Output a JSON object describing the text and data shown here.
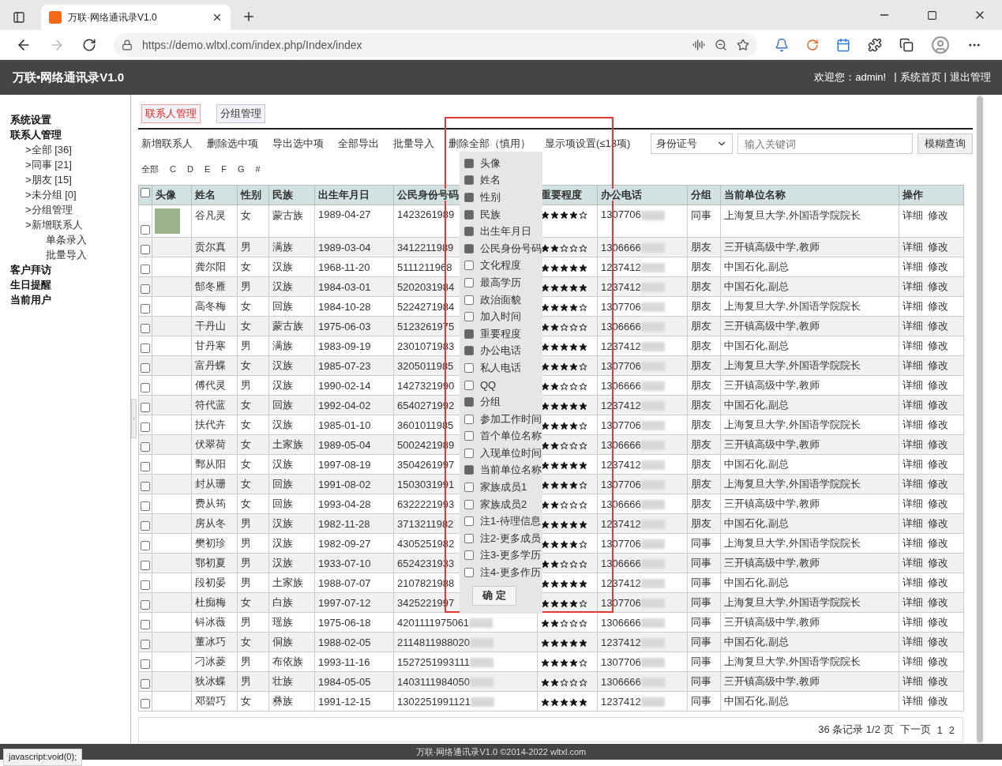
{
  "browser": {
    "tab_title": "万联·网络通讯录V1.0",
    "url": "https://demo.wltxl.com/index.php/Index/index"
  },
  "header": {
    "title": "万联•网络通讯录V1.0",
    "items": [
      {
        "kind": "text",
        "label": "欢迎您：admin!"
      },
      {
        "kind": "separator",
        "label": "|"
      },
      {
        "kind": "link",
        "label": "系统首页"
      },
      {
        "kind": "separator",
        "label": "|"
      },
      {
        "kind": "link",
        "label": "退出管理"
      }
    ]
  },
  "sidebar": {
    "items": [
      {
        "label": "系统设置"
      },
      {
        "label": "联系人管理",
        "children": [
          {
            "label": ">全部 [36]"
          },
          {
            "label": ">同事 [21]"
          },
          {
            "label": ">朋友 [15]"
          },
          {
            "label": ">未分组 [0]"
          },
          {
            "label": ">分组管理"
          },
          {
            "label": ">新增联系人",
            "children": [
              {
                "label": "单条录入"
              },
              {
                "label": "批量导入"
              }
            ]
          }
        ]
      },
      {
        "label": "客户拜访"
      },
      {
        "label": "生日提醒"
      },
      {
        "label": "当前用户"
      }
    ]
  },
  "tabs": [
    {
      "label": "联系人管理",
      "selected": true
    },
    {
      "label": "分组管理",
      "selected": false
    }
  ],
  "toolbar": {
    "actions": [
      "新增联系人",
      "删除选中项",
      "导出选中项",
      "全部导出",
      "批量导入",
      "删除全部（慎用）",
      "显示项设置(≤13项)"
    ],
    "letters": [
      "全部",
      "C",
      "D",
      "E",
      "F",
      "G",
      "#"
    ]
  },
  "search": {
    "field": "身份证号",
    "placeholder": "输入关键词",
    "button": "模糊查询"
  },
  "table": {
    "select_all_checked": false,
    "columns": [
      "头像",
      "姓名",
      "性别",
      "民族",
      "出生年月日",
      "公民身份号码",
      "重要程度",
      "办公电话",
      "分组",
      "当前单位名称",
      "操作"
    ],
    "rows": [
      {
        "checked": false,
        "photo": true,
        "name": "谷凡灵",
        "gender": "女",
        "ethnicity": "蒙古族",
        "birth": "1989-04-27",
        "id": "1423261989",
        "id_blurred": false,
        "stars": 4,
        "phone": "1307706",
        "group": "同事",
        "company": "上海复旦大学,外国语学院院长",
        "actions": [
          "详细",
          "修改"
        ]
      },
      {
        "checked": false,
        "photo": false,
        "name": "贡尔真",
        "gender": "男",
        "ethnicity": "满族",
        "birth": "1989-03-04",
        "id": "3412211989",
        "id_blurred": false,
        "stars": 2,
        "phone": "1306666",
        "group": "朋友",
        "company": "三开镇高级中学,教师",
        "actions": [
          "详细",
          "修改"
        ]
      },
      {
        "checked": false,
        "photo": false,
        "name": "龚尔阳",
        "gender": "女",
        "ethnicity": "汉族",
        "birth": "1968-11-20",
        "id": "5111211968",
        "id_blurred": false,
        "stars": 5,
        "phone": "1237412",
        "group": "朋友",
        "company": "中国石化,副总",
        "actions": [
          "详细",
          "修改"
        ]
      },
      {
        "checked": false,
        "photo": false,
        "name": "郜冬雁",
        "gender": "男",
        "ethnicity": "汉族",
        "birth": "1984-03-01",
        "id": "5202031984",
        "id_blurred": false,
        "stars": 5,
        "phone": "1237412",
        "group": "朋友",
        "company": "中国石化,副总",
        "actions": [
          "详细",
          "修改"
        ]
      },
      {
        "checked": false,
        "photo": false,
        "name": "高冬梅",
        "gender": "女",
        "ethnicity": "回族",
        "birth": "1984-10-28",
        "id": "5224271984",
        "id_blurred": false,
        "stars": 4,
        "phone": "1307706",
        "group": "朋友",
        "company": "上海复旦大学,外国语学院院长",
        "actions": [
          "详细",
          "修改"
        ]
      },
      {
        "checked": false,
        "photo": false,
        "name": "干丹山",
        "gender": "女",
        "ethnicity": "蒙古族",
        "birth": "1975-06-03",
        "id": "5123261975",
        "id_blurred": false,
        "stars": 2,
        "phone": "1306666",
        "group": "朋友",
        "company": "三开镇高级中学,教师",
        "actions": [
          "详细",
          "修改"
        ]
      },
      {
        "checked": false,
        "photo": false,
        "name": "甘丹寒",
        "gender": "男",
        "ethnicity": "满族",
        "birth": "1983-09-19",
        "id": "2301071983",
        "id_blurred": false,
        "stars": 5,
        "phone": "1237412",
        "group": "朋友",
        "company": "中国石化,副总",
        "actions": [
          "详细",
          "修改"
        ]
      },
      {
        "checked": false,
        "photo": false,
        "name": "富丹蝶",
        "gender": "女",
        "ethnicity": "汉族",
        "birth": "1985-07-23",
        "id": "3205011985",
        "id_blurred": false,
        "stars": 4,
        "phone": "1307706",
        "group": "朋友",
        "company": "上海复旦大学,外国语学院院长",
        "actions": [
          "详细",
          "修改"
        ]
      },
      {
        "checked": false,
        "photo": false,
        "name": "傅代灵",
        "gender": "男",
        "ethnicity": "汉族",
        "birth": "1990-02-14",
        "id": "1427321990",
        "id_blurred": false,
        "stars": 2,
        "phone": "1306666",
        "group": "朋友",
        "company": "三开镇高级中学,教师",
        "actions": [
          "详细",
          "修改"
        ]
      },
      {
        "checked": false,
        "photo": false,
        "name": "符代蓝",
        "gender": "女",
        "ethnicity": "回族",
        "birth": "1992-04-02",
        "id": "6540271992",
        "id_blurred": false,
        "stars": 5,
        "phone": "1237412",
        "group": "朋友",
        "company": "中国石化,副总",
        "actions": [
          "详细",
          "修改"
        ]
      },
      {
        "checked": false,
        "photo": false,
        "name": "扶代卉",
        "gender": "女",
        "ethnicity": "汉族",
        "birth": "1985-01-10",
        "id": "3601011985",
        "id_blurred": false,
        "stars": 4,
        "phone": "1307706",
        "group": "朋友",
        "company": "上海复旦大学,外国语学院院长",
        "actions": [
          "详细",
          "修改"
        ]
      },
      {
        "checked": false,
        "photo": false,
        "name": "伏翠荷",
        "gender": "女",
        "ethnicity": "土家族",
        "birth": "1989-05-04",
        "id": "5002421989",
        "id_blurred": false,
        "stars": 2,
        "phone": "1306666",
        "group": "朋友",
        "company": "三开镇高级中学,教师",
        "actions": [
          "详细",
          "修改"
        ]
      },
      {
        "checked": false,
        "photo": false,
        "name": "鄄从阳",
        "gender": "女",
        "ethnicity": "汉族",
        "birth": "1997-08-19",
        "id": "3504261997",
        "id_blurred": false,
        "stars": 5,
        "phone": "1237412",
        "group": "朋友",
        "company": "中国石化,副总",
        "actions": [
          "详细",
          "修改"
        ]
      },
      {
        "checked": false,
        "photo": false,
        "name": "封从珊",
        "gender": "女",
        "ethnicity": "回族",
        "birth": "1991-08-02",
        "id": "1503031991",
        "id_blurred": false,
        "stars": 4,
        "phone": "1307706",
        "group": "朋友",
        "company": "上海复旦大学,外国语学院院长",
        "actions": [
          "详细",
          "修改"
        ]
      },
      {
        "checked": false,
        "photo": false,
        "name": "费从筠",
        "gender": "女",
        "ethnicity": "回族",
        "birth": "1993-04-28",
        "id": "6322221993",
        "id_blurred": false,
        "stars": 2,
        "phone": "1306666",
        "group": "朋友",
        "company": "三开镇高级中学,教师",
        "actions": [
          "详细",
          "修改"
        ]
      },
      {
        "checked": false,
        "photo": false,
        "name": "房从冬",
        "gender": "男",
        "ethnicity": "汉族",
        "birth": "1982-11-28",
        "id": "3713211982",
        "id_blurred": false,
        "stars": 5,
        "phone": "1237412",
        "group": "朋友",
        "company": "中国石化,副总",
        "actions": [
          "详细",
          "修改"
        ]
      },
      {
        "checked": false,
        "photo": false,
        "name": "樊初珍",
        "gender": "男",
        "ethnicity": "汉族",
        "birth": "1982-09-27",
        "id": "4305251982",
        "id_blurred": false,
        "stars": 4,
        "phone": "1307706",
        "group": "同事",
        "company": "上海复旦大学,外国语学院院长",
        "actions": [
          "详细",
          "修改"
        ]
      },
      {
        "checked": false,
        "photo": false,
        "name": "鄂初夏",
        "gender": "男",
        "ethnicity": "汉族",
        "birth": "1933-07-10",
        "id": "6524231933",
        "id_blurred": false,
        "stars": 2,
        "phone": "1306666",
        "group": "同事",
        "company": "三开镇高级中学,教师",
        "actions": [
          "详细",
          "修改"
        ]
      },
      {
        "checked": false,
        "photo": false,
        "name": "段初晏",
        "gender": "男",
        "ethnicity": "土家族",
        "birth": "1988-07-07",
        "id": "2107821988",
        "id_blurred": false,
        "stars": 5,
        "phone": "1237412",
        "group": "同事",
        "company": "中国石化,副总",
        "actions": [
          "详细",
          "修改"
        ]
      },
      {
        "checked": false,
        "photo": false,
        "name": "杜痴梅",
        "gender": "女",
        "ethnicity": "白族",
        "birth": "1997-07-12",
        "id": "3425221997",
        "id_blurred": false,
        "stars": 4,
        "phone": "1307706",
        "group": "同事",
        "company": "上海复旦大学,外国语学院院长",
        "actions": [
          "详细",
          "修改"
        ]
      },
      {
        "checked": false,
        "photo": false,
        "name": "钭冰薇",
        "gender": "男",
        "ethnicity": "瑶族",
        "birth": "1975-06-18",
        "id": "4201111975061",
        "id_blurred": true,
        "stars": 2,
        "phone": "1306666",
        "group": "同事",
        "company": "三开镇高级中学,教师",
        "actions": [
          "详细",
          "修改"
        ]
      },
      {
        "checked": false,
        "photo": false,
        "name": "董冰巧",
        "gender": "女",
        "ethnicity": "侗族",
        "birth": "1988-02-05",
        "id": "2114811988020",
        "id_blurred": true,
        "stars": 5,
        "phone": "1237412",
        "group": "同事",
        "company": "中国石化,副总",
        "actions": [
          "详细",
          "修改"
        ]
      },
      {
        "checked": false,
        "photo": false,
        "name": "刁冰菱",
        "gender": "男",
        "ethnicity": "布依族",
        "birth": "1993-11-16",
        "id": "1527251993111",
        "id_blurred": true,
        "stars": 4,
        "phone": "1307706",
        "group": "同事",
        "company": "上海复旦大学,外国语学院院长",
        "actions": [
          "详细",
          "修改"
        ]
      },
      {
        "checked": false,
        "photo": false,
        "name": "狄冰蝶",
        "gender": "男",
        "ethnicity": "壮族",
        "birth": "1984-05-05",
        "id": "1403111984050",
        "id_blurred": true,
        "stars": 2,
        "phone": "1306666",
        "group": "同事",
        "company": "三开镇高级中学,教师",
        "actions": [
          "详细",
          "修改"
        ]
      },
      {
        "checked": false,
        "photo": false,
        "name": "邓碧巧",
        "gender": "女",
        "ethnicity": "彝族",
        "birth": "1991-12-15",
        "id": "1302251991121",
        "id_blurred": true,
        "stars": 5,
        "phone": "1237412",
        "group": "同事",
        "company": "中国石化,副总",
        "actions": [
          "详细",
          "修改"
        ]
      }
    ]
  },
  "column_settings": {
    "items": [
      {
        "label": "头像",
        "checked": true
      },
      {
        "label": "姓名",
        "checked": true
      },
      {
        "label": "性别",
        "checked": true
      },
      {
        "label": "民族",
        "checked": true
      },
      {
        "label": "出生年月日",
        "checked": true
      },
      {
        "label": "公民身份号码",
        "checked": true
      },
      {
        "label": "文化程度",
        "checked": false
      },
      {
        "label": "最高学历",
        "checked": false
      },
      {
        "label": "政治面貌",
        "checked": false
      },
      {
        "label": "加入时间",
        "checked": false
      },
      {
        "label": "重要程度",
        "checked": true
      },
      {
        "label": "办公电话",
        "checked": true
      },
      {
        "label": "私人电话",
        "checked": false
      },
      {
        "label": "QQ",
        "checked": false
      },
      {
        "label": "分组",
        "checked": true
      },
      {
        "label": "参加工作时间",
        "checked": false
      },
      {
        "label": "首个单位名称",
        "checked": false
      },
      {
        "label": "入现单位时间",
        "checked": false
      },
      {
        "label": "当前单位名称",
        "checked": true
      },
      {
        "label": "家族成员1",
        "checked": false
      },
      {
        "label": "家族成员2",
        "checked": false
      },
      {
        "label": "注1-待理信息",
        "checked": false
      },
      {
        "label": "注2-更多成员",
        "checked": false
      },
      {
        "label": "注3-更多学历",
        "checked": false
      },
      {
        "label": "注4-更多作历",
        "checked": false
      }
    ],
    "button": "确 定"
  },
  "pagination": {
    "summary": "36 条记录 1/2 页",
    "next": "下一页",
    "pages": [
      "1",
      "2"
    ]
  },
  "footer": "万联·网络通讯录V1.0 ©2014-2022 wltxl.com",
  "status_bar": "javascript:void(0);"
}
